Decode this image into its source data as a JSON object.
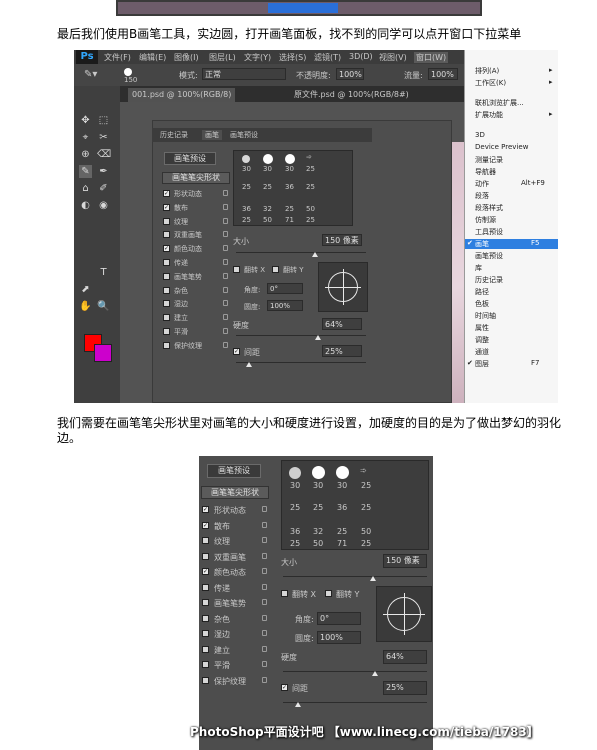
{
  "captions": {
    "line1": "最后我们使用B画笔工具，实边圆，打开画笔面板，找不到的同学可以点开窗口下拉菜单",
    "line2a": "我们需要在画笔笔尖形状里对画笔的大小和硬度进行设置，加硬度的目的是为了做出梦幻的羽化",
    "line2b": "边。"
  },
  "ps": {
    "logo": "Ps",
    "menu": [
      "文件(F)",
      "编辑(E)",
      "图像(I)",
      "图层(L)",
      "文字(Y)",
      "选择(S)",
      "滤镜(T)",
      "3D(D)",
      "视图(V)",
      "窗口(W)"
    ],
    "options": {
      "brush_size": "150",
      "mode_label": "模式:",
      "mode_value": "正常",
      "opacity_label": "不透明度:",
      "opacity_value": "100%",
      "flow_label": "流量:",
      "flow_value": "100%"
    },
    "doc_tabs": [
      "001.psd @ 100%(RGB/8)",
      "原文件.psd @ 100%(RGB/8#)"
    ],
    "panel_tabs": [
      "历史记录",
      "画笔",
      "画笔预设"
    ],
    "tools": [
      "✥",
      "⬚",
      "⌖",
      "✂",
      "⊕",
      "⌫",
      "✎",
      "✒",
      "⌂",
      "✐",
      "◐",
      "◉",
      "T",
      "⬈",
      "✋",
      "🔍"
    ],
    "window_menu": {
      "items": [
        "排列(A)",
        "工作区(K)",
        "扩展功能",
        "3D",
        "Device Preview",
        "测量记录",
        "导航器",
        "动作",
        "段落",
        "段落样式",
        "仿制源",
        "工具预设",
        "画笔",
        "画笔预设",
        "库",
        "历史记录",
        "路径",
        "色板",
        "时间轴",
        "属性",
        "调整",
        "通道",
        "图层"
      ],
      "shortcut_action": "Alt+F9",
      "shortcut_brush": "F5",
      "shortcut_layers": "F7",
      "extra": "联机浏览扩展..."
    }
  },
  "brush": {
    "preset_button": "画笔预设",
    "tip_shape": "画笔笔尖形状",
    "options": [
      {
        "label": "形状动态",
        "checked": true
      },
      {
        "label": "散布",
        "checked": true
      },
      {
        "label": "纹理",
        "checked": false
      },
      {
        "label": "双重画笔",
        "checked": false
      },
      {
        "label": "颜色动态",
        "checked": true
      },
      {
        "label": "传递",
        "checked": false
      },
      {
        "label": "画笔笔势",
        "checked": false
      },
      {
        "label": "杂色",
        "checked": false
      },
      {
        "label": "湿边",
        "checked": false
      },
      {
        "label": "建立",
        "checked": false
      },
      {
        "label": "平滑",
        "checked": false
      },
      {
        "label": "保护纹理",
        "checked": false
      }
    ],
    "grid_row1": [
      "30",
      "30",
      "30",
      "25"
    ],
    "grid_row2": [
      "25",
      "25",
      "36",
      "25"
    ],
    "grid_row3": [
      "36",
      "32",
      "25",
      "50"
    ],
    "grid_row4": [
      "25",
      "50",
      "71",
      "25"
    ],
    "size_label": "大小",
    "size_value": "150 像素",
    "flip_x": "翻转 X",
    "flip_y": "翻转 Y",
    "angle_label": "角度:",
    "angle_value": "0°",
    "roundness_label": "圆度:",
    "roundness_value": "100%",
    "hardness_label": "硬度",
    "hardness_value": "64%",
    "spacing_label": "间距",
    "spacing_value": "25%"
  },
  "watermark": "PhotoShop平面设计吧 【www.linecg.com/tieba/1783】",
  "colors": {
    "foreground": "#ff0000",
    "background": "#cc00cc",
    "highlight": "#2e7fe0"
  }
}
